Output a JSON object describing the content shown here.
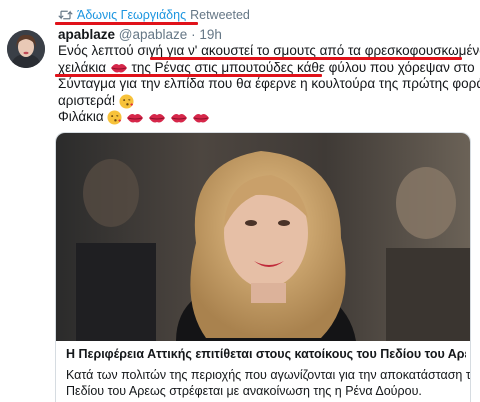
{
  "retweet": {
    "user": "Άδωνις Γεωργιάδης",
    "label": "Retweeted"
  },
  "tweet": {
    "name": "apablaze",
    "handle": "@apablaze",
    "separator": "·",
    "time": "19h",
    "lines": [
      "Ενός λεπτού σιγή για ν' ακουστεί το σμουτς από τα φρεσκοφουσκωμένα",
      "χειλάκια",
      "της Ρένας στις μπουτούδες κάθε φύλου που χόρεψαν στο",
      "Σύνταγμα για την ελπίδα που θα έφερνε η κουλτούρα της πρώτης φοράς",
      "αριστερά!",
      "Φιλάκια"
    ]
  },
  "card": {
    "title": "Η Περιφέρεια Αττικής επιτίθεται στους κατοίκους του Πεδίου του Αρε...",
    "description_lines": [
      "Κατά των πολιτών της περιοχής που αγωνίζονται για την αποκατάσταση του",
      "Πεδίου του Αρεως στρέφεται με ανακοίνωση της η Ρένα Δούρου."
    ]
  },
  "colors": {
    "link": "#1b95e0",
    "muted": "#657786",
    "annotation_red": "#e0121a"
  }
}
